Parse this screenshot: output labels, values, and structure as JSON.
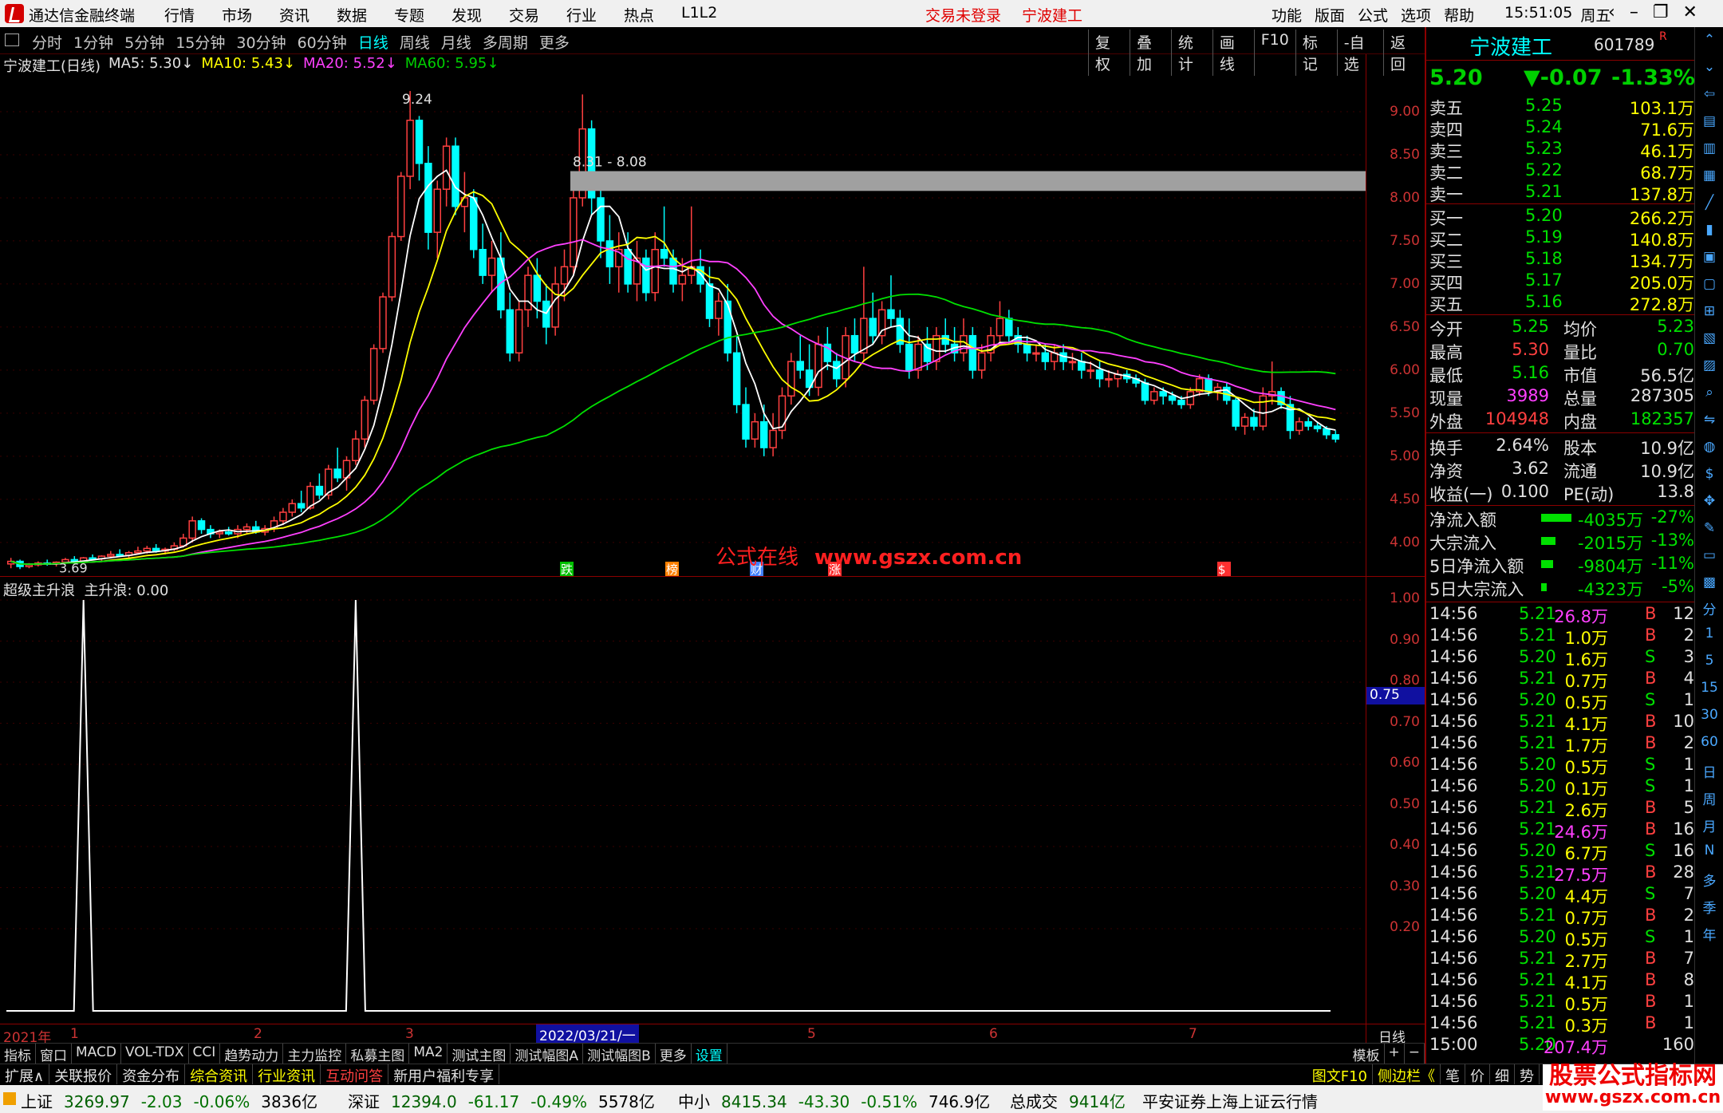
{
  "menubar": {
    "app": "通达信金融终端",
    "menus": [
      "行情",
      "市场",
      "资讯",
      "数据",
      "专题",
      "发现",
      "交易",
      "行业",
      "热点",
      "L1L2"
    ],
    "status": [
      "交易未登录",
      "宁波建工"
    ],
    "right": [
      "功能",
      "版面",
      "公式",
      "选项",
      "帮助"
    ],
    "time": "15:51:05",
    "weekday": "周五"
  },
  "periods": [
    "分时",
    "1分钟",
    "5分钟",
    "15分钟",
    "30分钟",
    "60分钟",
    "日线",
    "周线",
    "月线",
    "多周期",
    "更多"
  ],
  "tools": [
    "复权",
    "叠加",
    "统计",
    "画线",
    "F10",
    "标记",
    "-自选",
    "返回"
  ],
  "legend": {
    "title": "宁波建工(日线)",
    "ma5": "MA5: 5.30",
    "ma10": "MA10: 5.43",
    "ma20": "MA20: 5.52",
    "ma60": "MA60: 5.95"
  },
  "annotations": {
    "high": "9.24",
    "low": "3.69",
    "band": "8.31 - 8.08",
    "markers": [
      "跌",
      "榜",
      "财",
      "涨",
      "$"
    ]
  },
  "watermark": {
    "cn": "公式在线",
    "url": "www.gszx.com.cn"
  },
  "price_scale": [
    "9.00",
    "8.50",
    "8.00",
    "7.50",
    "7.00",
    "6.50",
    "6.00",
    "5.50",
    "5.00",
    "4.50",
    "4.00"
  ],
  "sub_scale": [
    "1.00",
    "0.90",
    "0.80",
    "0.70",
    "0.60",
    "0.50",
    "0.40",
    "0.30",
    "0.20"
  ],
  "sub_marker": "0.75",
  "indicator": {
    "name": "超级主升浪",
    "value": "主升浪: 0.00"
  },
  "datebar": {
    "year": "2021年",
    "months": [
      "1",
      "2",
      "3",
      "4",
      "5",
      "6",
      "7"
    ],
    "cursor": "2022/03/21/一",
    "period": "日线"
  },
  "tabs": [
    "指标",
    "窗口",
    "MACD",
    "VOL-TDX",
    "CCI",
    "趋势动力",
    "主力监控",
    "私募主图",
    "MA2",
    "测试主图",
    "测试幅图A",
    "测试幅图B",
    "更多",
    "设置"
  ],
  "tabs_right": [
    "模板",
    "+",
    "−"
  ],
  "toolbar2": [
    "扩展∧",
    "关联报价",
    "资金分布",
    "综合资讯",
    "行业资讯",
    "互动问答",
    "新用户福利专享"
  ],
  "toolbar2_right": [
    "图文F10",
    "侧边栏《",
    "笔",
    "价",
    "细",
    "势"
  ],
  "quote": {
    "name": "宁波建工",
    "code": "601789",
    "flag": "R",
    "price": "5.20",
    "change": "▼-0.07",
    "pct": "-1.33%",
    "asks": [
      [
        "卖五",
        "5.25",
        "103.1万"
      ],
      [
        "卖四",
        "5.24",
        "71.6万"
      ],
      [
        "卖三",
        "5.23",
        "46.1万"
      ],
      [
        "卖二",
        "5.22",
        "68.7万"
      ],
      [
        "卖一",
        "5.21",
        "137.8万"
      ]
    ],
    "bids": [
      [
        "买一",
        "5.20",
        "266.2万"
      ],
      [
        "买二",
        "5.19",
        "140.8万"
      ],
      [
        "买三",
        "5.18",
        "134.7万"
      ],
      [
        "买四",
        "5.17",
        "205.0万"
      ],
      [
        "买五",
        "5.16",
        "272.8万"
      ]
    ],
    "stats": [
      [
        "今开",
        "5.25",
        "均价",
        "5.23"
      ],
      [
        "最高",
        "5.30",
        "量比",
        "0.70"
      ],
      [
        "最低",
        "5.16",
        "市值",
        "56.5亿"
      ],
      [
        "现量",
        "3989",
        "总量",
        "287305"
      ],
      [
        "外盘",
        "104948",
        "内盘",
        "182357"
      ]
    ],
    "stats2": [
      [
        "换手",
        "2.64%",
        "股本",
        "10.9亿"
      ],
      [
        "净资",
        "3.62",
        "流通",
        "10.9亿"
      ],
      [
        "收益(一)",
        "0.100",
        "PE(动)",
        "13.8"
      ]
    ],
    "flows": [
      [
        "净流入额",
        "-4035万",
        "-27%",
        0.27
      ],
      [
        "大宗流入",
        "-2015万",
        "-13%",
        0.13
      ],
      [
        "5日净流入额",
        "-9804万",
        "-11%",
        0.11
      ],
      [
        "5日大宗流入",
        "-4323万",
        "-5%",
        0.05
      ]
    ],
    "ticks": [
      [
        "14:56",
        "5.21",
        "26.8万",
        "B",
        "12"
      ],
      [
        "14:56",
        "5.21",
        "1.0万",
        "B",
        "2"
      ],
      [
        "14:56",
        "5.20",
        "1.6万",
        "S",
        "3"
      ],
      [
        "14:56",
        "5.21",
        "0.7万",
        "B",
        "4"
      ],
      [
        "14:56",
        "5.20",
        "0.5万",
        "S",
        "1"
      ],
      [
        "14:56",
        "5.21",
        "4.1万",
        "B",
        "10"
      ],
      [
        "14:56",
        "5.21",
        "1.7万",
        "B",
        "2"
      ],
      [
        "14:56",
        "5.20",
        "0.5万",
        "S",
        "1"
      ],
      [
        "14:56",
        "5.20",
        "0.1万",
        "S",
        "1"
      ],
      [
        "14:56",
        "5.21",
        "2.6万",
        "B",
        "5"
      ],
      [
        "14:56",
        "5.21",
        "24.6万",
        "B",
        "16"
      ],
      [
        "14:56",
        "5.20",
        "6.7万",
        "S",
        "16"
      ],
      [
        "14:56",
        "5.21",
        "27.5万",
        "B",
        "28"
      ],
      [
        "14:56",
        "5.20",
        "4.4万",
        "S",
        "7"
      ],
      [
        "14:56",
        "5.21",
        "0.7万",
        "B",
        "2"
      ],
      [
        "14:56",
        "5.20",
        "0.5万",
        "S",
        "1"
      ],
      [
        "14:56",
        "5.21",
        "2.7万",
        "B",
        "7"
      ],
      [
        "14:56",
        "5.21",
        "4.1万",
        "B",
        "8"
      ],
      [
        "14:56",
        "5.21",
        "0.5万",
        "B",
        "1"
      ],
      [
        "14:56",
        "5.21",
        "0.3万",
        "B",
        "1"
      ],
      [
        "15:00",
        "5.20",
        "207.4万",
        "",
        "160"
      ]
    ]
  },
  "sidenav": [
    "分",
    "1",
    "5",
    "15",
    "30",
    "60",
    "日",
    "周",
    "月",
    "N",
    "多",
    "季",
    "年"
  ],
  "statusbar": {
    "sh": [
      "上证",
      "3269.97",
      "-2.03",
      "-0.06%",
      "3836亿"
    ],
    "sz": [
      "深证",
      "12394.0",
      "-61.17",
      "-0.49%",
      "5578亿"
    ],
    "zx": [
      "中小",
      "8415.34",
      "-43.30",
      "-0.51%",
      "746.9亿"
    ],
    "total": [
      "总成交",
      "9414亿"
    ],
    "info": "平安证券上海上证云行情"
  },
  "site_logo": {
    "line1": "股票公式指标网",
    "line2": "www.gszx.com.cn"
  },
  "chart_data": {
    "type": "candlestick",
    "ylim": [
      3.6,
      9.5
    ],
    "ohlc": [
      [
        3.75,
        3.82,
        3.7,
        3.78
      ],
      [
        3.78,
        3.8,
        3.69,
        3.72
      ],
      [
        3.72,
        3.76,
        3.7,
        3.74
      ],
      [
        3.74,
        3.78,
        3.72,
        3.76
      ],
      [
        3.76,
        3.8,
        3.73,
        3.75
      ],
      [
        3.75,
        3.78,
        3.72,
        3.77
      ],
      [
        3.77,
        3.82,
        3.75,
        3.8
      ],
      [
        3.8,
        3.84,
        3.77,
        3.78
      ],
      [
        3.78,
        3.83,
        3.76,
        3.82
      ],
      [
        3.82,
        3.86,
        3.79,
        3.81
      ],
      [
        3.81,
        3.85,
        3.78,
        3.84
      ],
      [
        3.84,
        3.9,
        3.82,
        3.86
      ],
      [
        3.86,
        3.92,
        3.83,
        3.85
      ],
      [
        3.85,
        3.9,
        3.82,
        3.88
      ],
      [
        3.88,
        3.95,
        3.86,
        3.9
      ],
      [
        3.9,
        3.96,
        3.87,
        3.93
      ],
      [
        3.93,
        3.98,
        3.88,
        3.9
      ],
      [
        3.9,
        3.94,
        3.86,
        3.92
      ],
      [
        3.92,
        4.0,
        3.9,
        3.96
      ],
      [
        3.96,
        4.1,
        3.94,
        4.05
      ],
      [
        4.05,
        4.3,
        4.0,
        4.25
      ],
      [
        4.25,
        4.28,
        4.1,
        4.15
      ],
      [
        4.15,
        4.2,
        4.05,
        4.1
      ],
      [
        4.1,
        4.15,
        4.05,
        4.12
      ],
      [
        4.12,
        4.18,
        4.08,
        4.1
      ],
      [
        4.1,
        4.2,
        4.05,
        4.15
      ],
      [
        4.15,
        4.22,
        4.1,
        4.18
      ],
      [
        4.18,
        4.25,
        4.1,
        4.12
      ],
      [
        4.12,
        4.2,
        4.08,
        4.16
      ],
      [
        4.16,
        4.3,
        4.12,
        4.25
      ],
      [
        4.25,
        4.4,
        4.2,
        4.35
      ],
      [
        4.35,
        4.5,
        4.3,
        4.45
      ],
      [
        4.45,
        4.6,
        4.35,
        4.4
      ],
      [
        4.4,
        4.7,
        4.38,
        4.65
      ],
      [
        4.65,
        4.8,
        4.5,
        4.55
      ],
      [
        4.55,
        4.9,
        4.5,
        4.85
      ],
      [
        4.85,
        5.1,
        4.7,
        4.75
      ],
      [
        4.75,
        5.0,
        4.6,
        4.95
      ],
      [
        4.95,
        5.3,
        4.9,
        5.2
      ],
      [
        5.2,
        5.7,
        5.1,
        5.65
      ],
      [
        5.65,
        6.3,
        5.6,
        6.25
      ],
      [
        6.25,
        6.9,
        6.2,
        6.85
      ],
      [
        6.85,
        7.6,
        6.8,
        7.55
      ],
      [
        7.55,
        8.3,
        7.5,
        8.25
      ],
      [
        8.25,
        9.24,
        8.1,
        8.9
      ],
      [
        8.9,
        8.95,
        8.2,
        8.4
      ],
      [
        8.4,
        8.6,
        7.4,
        7.6
      ],
      [
        7.6,
        8.2,
        7.3,
        8.1
      ],
      [
        8.1,
        8.7,
        7.9,
        8.6
      ],
      [
        8.6,
        8.7,
        7.8,
        7.9
      ],
      [
        7.9,
        8.3,
        7.6,
        8.0
      ],
      [
        8.0,
        8.1,
        7.3,
        7.4
      ],
      [
        7.4,
        7.7,
        7.0,
        7.1
      ],
      [
        7.1,
        7.5,
        6.9,
        7.3
      ],
      [
        7.3,
        7.6,
        6.6,
        6.7
      ],
      [
        6.7,
        6.9,
        6.1,
        6.2
      ],
      [
        6.2,
        6.8,
        6.1,
        6.7
      ],
      [
        6.7,
        7.2,
        6.5,
        7.1
      ],
      [
        7.1,
        7.3,
        6.6,
        6.8
      ],
      [
        6.8,
        7.0,
        6.3,
        6.5
      ],
      [
        6.5,
        7.2,
        6.4,
        7.0
      ],
      [
        7.0,
        7.4,
        6.8,
        7.2
      ],
      [
        7.2,
        8.1,
        7.1,
        8.0
      ],
      [
        8.0,
        9.2,
        7.9,
        8.8
      ],
      [
        8.8,
        8.9,
        7.8,
        8.0
      ],
      [
        8.0,
        8.3,
        7.3,
        7.5
      ],
      [
        7.5,
        7.8,
        7.0,
        7.2
      ],
      [
        7.2,
        7.6,
        6.9,
        7.4
      ],
      [
        7.4,
        7.6,
        6.9,
        7.0
      ],
      [
        7.0,
        7.5,
        6.8,
        7.3
      ],
      [
        7.3,
        7.4,
        6.8,
        6.9
      ],
      [
        6.9,
        7.6,
        6.8,
        7.4
      ],
      [
        7.4,
        7.9,
        7.2,
        7.3
      ],
      [
        7.3,
        7.4,
        6.9,
        7.0
      ],
      [
        7.0,
        7.3,
        6.8,
        7.1
      ],
      [
        7.1,
        7.9,
        7.0,
        7.2
      ],
      [
        7.2,
        7.4,
        6.9,
        7.0
      ],
      [
        7.0,
        7.2,
        6.5,
        6.6
      ],
      [
        6.6,
        6.9,
        6.4,
        6.8
      ],
      [
        6.8,
        7.0,
        6.1,
        6.2
      ],
      [
        6.2,
        6.4,
        5.5,
        5.6
      ],
      [
        5.6,
        5.8,
        5.1,
        5.2
      ],
      [
        5.2,
        5.5,
        5.1,
        5.4
      ],
      [
        5.4,
        5.6,
        5.0,
        5.1
      ],
      [
        5.1,
        5.5,
        5.0,
        5.3
      ],
      [
        5.3,
        5.8,
        5.2,
        5.7
      ],
      [
        5.7,
        6.2,
        5.6,
        6.1
      ],
      [
        6.1,
        6.4,
        5.9,
        6.0
      ],
      [
        6.0,
        6.3,
        5.7,
        5.8
      ],
      [
        5.8,
        6.4,
        5.7,
        6.3
      ],
      [
        6.3,
        6.5,
        6.0,
        6.1
      ],
      [
        6.1,
        6.2,
        5.8,
        5.9
      ],
      [
        5.9,
        6.5,
        5.8,
        6.4
      ],
      [
        6.4,
        6.6,
        6.1,
        6.2
      ],
      [
        6.2,
        7.2,
        6.1,
        6.6
      ],
      [
        6.6,
        6.9,
        6.3,
        6.4
      ],
      [
        6.4,
        6.8,
        6.3,
        6.7
      ],
      [
        6.7,
        7.1,
        6.5,
        6.6
      ],
      [
        6.6,
        6.7,
        6.2,
        6.3
      ],
      [
        6.3,
        6.6,
        5.9,
        6.0
      ],
      [
        6.0,
        6.4,
        5.9,
        6.3
      ],
      [
        6.3,
        6.5,
        6.0,
        6.1
      ],
      [
        6.1,
        6.5,
        6.0,
        6.4
      ],
      [
        6.4,
        6.6,
        6.2,
        6.3
      ],
      [
        6.3,
        6.5,
        6.1,
        6.2
      ],
      [
        6.2,
        6.6,
        6.1,
        6.4
      ],
      [
        6.4,
        6.5,
        5.9,
        6.0
      ],
      [
        6.0,
        6.3,
        5.9,
        6.2
      ],
      [
        6.2,
        6.5,
        6.1,
        6.4
      ],
      [
        6.4,
        6.8,
        6.3,
        6.6
      ],
      [
        6.6,
        6.7,
        6.3,
        6.4
      ],
      [
        6.4,
        6.5,
        6.2,
        6.3
      ],
      [
        6.3,
        6.4,
        6.1,
        6.2
      ],
      [
        6.2,
        6.3,
        6.1,
        6.2
      ],
      [
        6.2,
        6.3,
        6.0,
        6.1
      ],
      [
        6.1,
        6.3,
        6.0,
        6.2
      ],
      [
        6.2,
        6.3,
        6.0,
        6.1
      ],
      [
        6.1,
        6.2,
        6.0,
        6.1
      ],
      [
        6.1,
        6.2,
        5.9,
        6.0
      ],
      [
        6.0,
        6.1,
        5.9,
        6.0
      ],
      [
        6.0,
        6.1,
        5.8,
        5.9
      ],
      [
        5.9,
        6.0,
        5.8,
        5.9
      ],
      [
        5.9,
        6.0,
        5.8,
        5.95
      ],
      [
        5.95,
        6.0,
        5.85,
        5.9
      ],
      [
        5.9,
        5.95,
        5.8,
        5.85
      ],
      [
        5.85,
        5.9,
        5.6,
        5.65
      ],
      [
        5.65,
        5.8,
        5.6,
        5.75
      ],
      [
        5.75,
        5.8,
        5.6,
        5.7
      ],
      [
        5.7,
        5.75,
        5.6,
        5.65
      ],
      [
        5.65,
        5.7,
        5.55,
        5.6
      ],
      [
        5.6,
        5.8,
        5.55,
        5.75
      ],
      [
        5.75,
        5.95,
        5.7,
        5.9
      ],
      [
        5.9,
        5.95,
        5.7,
        5.75
      ],
      [
        5.75,
        5.85,
        5.65,
        5.8
      ],
      [
        5.8,
        5.85,
        5.6,
        5.65
      ],
      [
        5.65,
        5.7,
        5.3,
        5.35
      ],
      [
        5.35,
        5.5,
        5.25,
        5.45
      ],
      [
        5.45,
        5.55,
        5.3,
        5.35
      ],
      [
        5.35,
        5.8,
        5.3,
        5.7
      ],
      [
        5.7,
        6.1,
        5.6,
        5.75
      ],
      [
        5.75,
        5.8,
        5.55,
        5.6
      ],
      [
        5.6,
        5.7,
        5.2,
        5.3
      ],
      [
        5.3,
        5.45,
        5.25,
        5.4
      ],
      [
        5.4,
        5.45,
        5.3,
        5.35
      ],
      [
        5.35,
        5.4,
        5.28,
        5.32
      ],
      [
        5.32,
        5.35,
        5.2,
        5.25
      ],
      [
        5.25,
        5.3,
        5.16,
        5.2
      ]
    ],
    "ma": [
      {
        "name": "MA5",
        "color": "#ffffff"
      },
      {
        "name": "MA10",
        "color": "#ffff00"
      },
      {
        "name": "MA20",
        "color": "#ff40ff"
      },
      {
        "name": "MA60",
        "color": "#00e000"
      }
    ],
    "indicator_spikes": [
      8,
      38
    ],
    "indicator_ylim": [
      0,
      1
    ]
  }
}
